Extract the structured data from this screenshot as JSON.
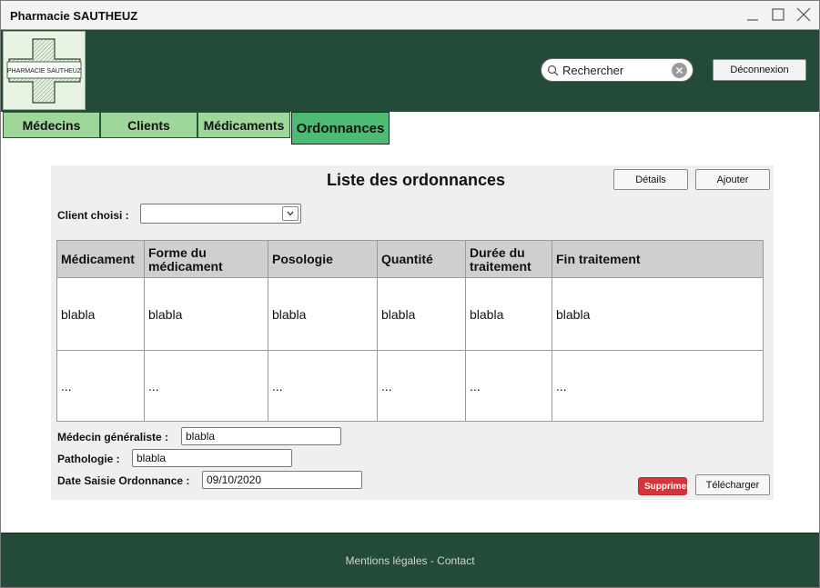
{
  "window": {
    "title": "Pharmacie SAUTHEUZ"
  },
  "header": {
    "logo_text": "PHARMACIE SAUTHEUZ",
    "search_placeholder": "Rechercher",
    "logout_label": "Déconnexion"
  },
  "tabs": [
    {
      "label": "Médecins"
    },
    {
      "label": "Clients"
    },
    {
      "label": "Médicaments"
    },
    {
      "label": "Ordonnances"
    }
  ],
  "panel": {
    "title": "Liste des ordonnances",
    "details_label": "Détails",
    "add_label": "Ajouter",
    "client_label": "Client choisi :",
    "client_value": ""
  },
  "table": {
    "columns": [
      "Médicament",
      "Forme du médicament",
      "Posologie",
      "Quantité",
      "Durée du traitement",
      "Fin traitement"
    ],
    "rows": [
      [
        "blabla",
        "blabla",
        "blabla",
        "blabla",
        "blabla",
        "blabla"
      ],
      [
        "...",
        "...",
        "...",
        "...",
        "...",
        "..."
      ]
    ]
  },
  "details": {
    "doctor_label": "Médecin généraliste :",
    "doctor_value": "blabla",
    "pathology_label": "Pathologie :",
    "pathology_value": "blabla",
    "date_label": "Date Saisie Ordonnance :",
    "date_value": "09/10/2020"
  },
  "actions": {
    "delete_label": "Supprimer",
    "download_label": "Télécharger"
  },
  "footer": {
    "text": "Mentions légales - Contact"
  },
  "colors": {
    "header_bg": "#244b38",
    "tab_bg": "#9fd69a",
    "tab_active_bg": "#4dbb73",
    "danger": "#d4353b"
  }
}
